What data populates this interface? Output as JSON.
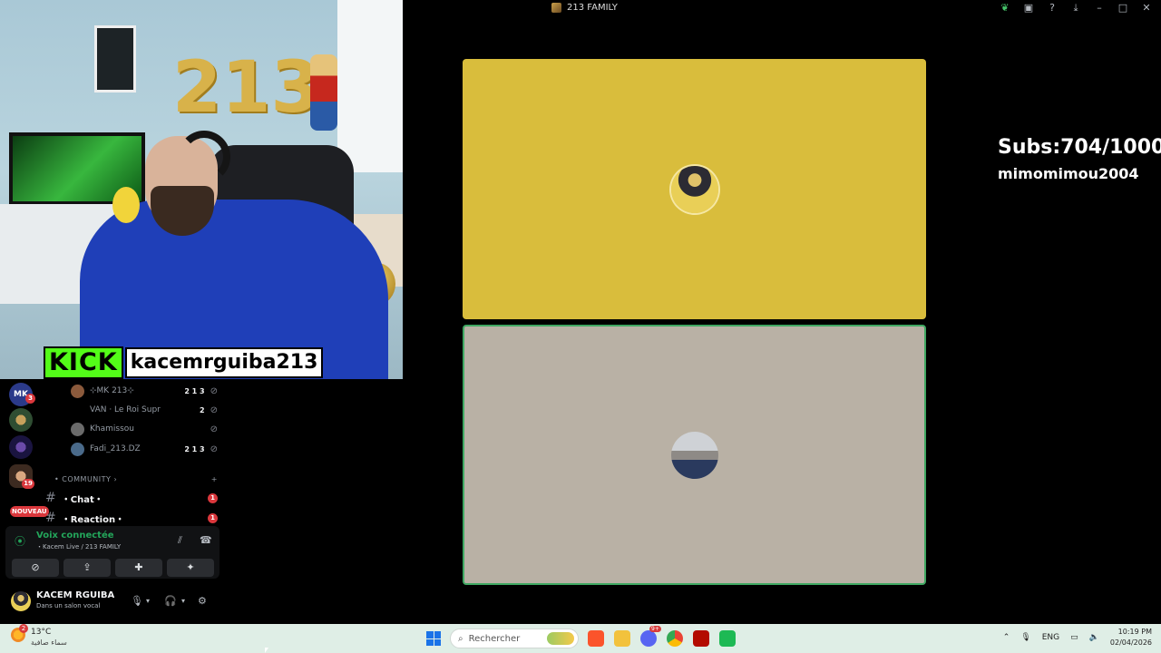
{
  "window": {
    "title": "213 FAMILY"
  },
  "stream_overlay": {
    "kick_logo": "KICK",
    "kick_username": "kacemrguiba213",
    "subs_text": "Subs:704/1000",
    "recent_sub": "mimomimou2004",
    "room_number": "213"
  },
  "server_rail": {
    "items": [
      {
        "label": "MK",
        "badge": "3"
      },
      {
        "label": "",
        "badge": ""
      },
      {
        "label": "",
        "badge": ""
      },
      {
        "label": "",
        "badge": "19"
      }
    ],
    "nouveau_label": "NOUVEAU"
  },
  "voice_members": [
    {
      "name": "⊹MK 213⊹",
      "tag": "2 1 3",
      "color": "#8b5a3c"
    },
    {
      "name": "VAN · Le Roi Supr",
      "tag": "2",
      "color": "#000000"
    },
    {
      "name": "Khamissou",
      "tag": "",
      "color": "#6b6b6b"
    },
    {
      "name": "Fadi_213.DZ",
      "tag": "2 1 3",
      "color": "#4a6a8a"
    }
  ],
  "category": {
    "label": "• COMMUNITY ›",
    "add": "+"
  },
  "channels": [
    {
      "name": "・Chat・",
      "unread": "1"
    },
    {
      "name": "・Reaction・",
      "unread": "1"
    }
  ],
  "voice_panel": {
    "status": "Voix connectée",
    "subtitle": "・Kacem Live / 213 FAMILY",
    "buttons": [
      "camera-off",
      "screen-share",
      "activities",
      "soundboard"
    ]
  },
  "user_panel": {
    "name": "KACEM RGUIBA",
    "subtitle": "Dans un salon vocal"
  },
  "taskbar": {
    "temperature": "13°C",
    "weather_desc": "سماء صافية",
    "weather_badge": "2",
    "search_placeholder": "Rechercher",
    "discord_badge": "9+",
    "language": "ENG",
    "time": "10:19 PM",
    "date": "02/04/2026"
  }
}
